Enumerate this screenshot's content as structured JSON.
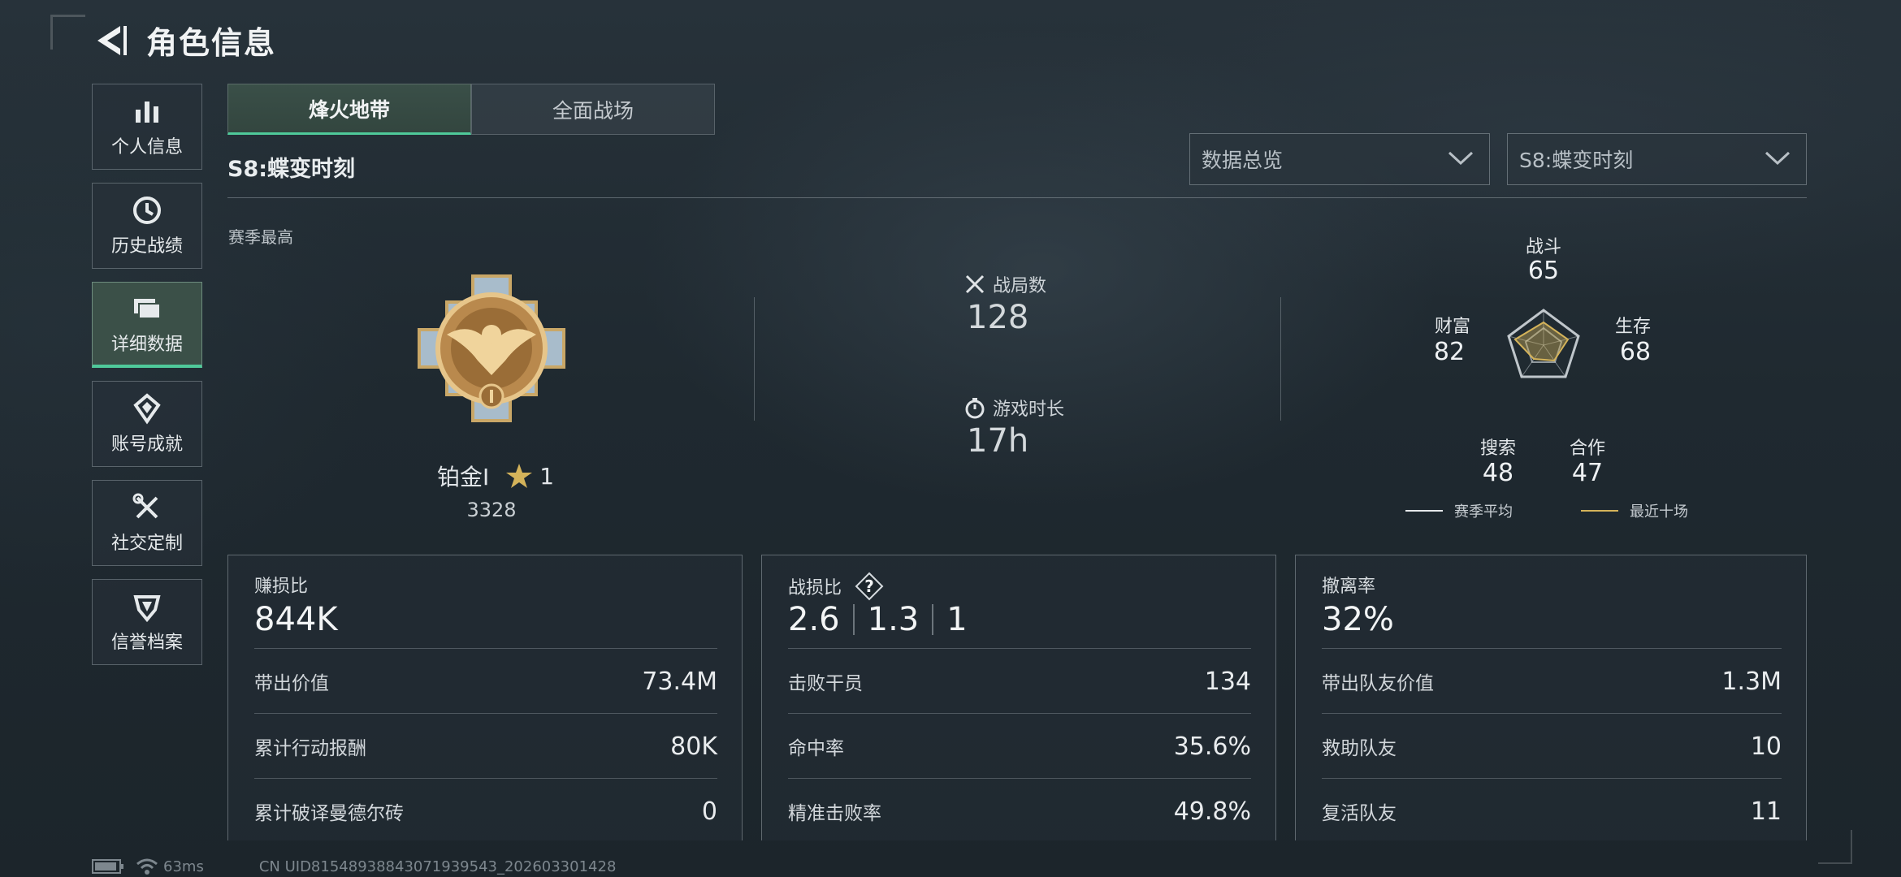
{
  "header": {
    "title": "角色信息"
  },
  "sidebar": {
    "items": [
      {
        "label": "个人信息",
        "icon": "bar-chart-icon"
      },
      {
        "label": "历史战绩",
        "icon": "clock-icon"
      },
      {
        "label": "详细数据",
        "icon": "folders-icon"
      },
      {
        "label": "账号成就",
        "icon": "achievement-icon"
      },
      {
        "label": "社交定制",
        "icon": "tools-icon"
      },
      {
        "label": "信誉档案",
        "icon": "shield-icon"
      }
    ],
    "active_index": 2
  },
  "tabs": [
    {
      "label": "烽火地带"
    },
    {
      "label": "全面战场"
    }
  ],
  "season_title": "S8:蝶变时刻",
  "filters": {
    "data_type": "数据总览",
    "season": "S8:蝶变时刻"
  },
  "season_high_label": "赛季最高",
  "rank": {
    "name": "铂金I",
    "stars": "1",
    "score": "3328"
  },
  "summary": {
    "matches_label": "战局数",
    "matches_value": "128",
    "playtime_label": "游戏时长",
    "playtime_value": "17h"
  },
  "radar": {
    "axes": [
      {
        "label": "战斗",
        "value": "65"
      },
      {
        "label": "生存",
        "value": "68"
      },
      {
        "label": "合作",
        "value": "47"
      },
      {
        "label": "搜索",
        "value": "48"
      },
      {
        "label": "财富",
        "value": "82"
      }
    ],
    "legend": [
      {
        "label": "赛季平均",
        "color": "#e6e9eb"
      },
      {
        "label": "最近十场",
        "color": "#d4b35a"
      }
    ]
  },
  "cards": {
    "profit": {
      "label": "赚损比",
      "value": "844K",
      "rows": [
        {
          "k": "带出价值",
          "v": "73.4M"
        },
        {
          "k": "累计行动报酬",
          "v": "80K"
        },
        {
          "k": "累计破译曼德尔砖",
          "v": "0"
        }
      ]
    },
    "combat": {
      "label": "战损比",
      "values": [
        "2.6",
        "1.3",
        "1"
      ],
      "rows": [
        {
          "k": "击败干员",
          "v": "134"
        },
        {
          "k": "命中率",
          "v": "35.6%"
        },
        {
          "k": "精准击败率",
          "v": "49.8%"
        }
      ]
    },
    "extract": {
      "label": "撤离率",
      "value": "32%",
      "rows": [
        {
          "k": "带出队友价值",
          "v": "1.3M"
        },
        {
          "k": "救助队友",
          "v": "10"
        },
        {
          "k": "复活队友",
          "v": "11"
        }
      ]
    }
  },
  "footer": {
    "ping": "63ms",
    "uid": "CN UID81548938843071939543_202603301428"
  },
  "colors": {
    "accent": "#4fc99a",
    "gold": "#d4b35a"
  }
}
